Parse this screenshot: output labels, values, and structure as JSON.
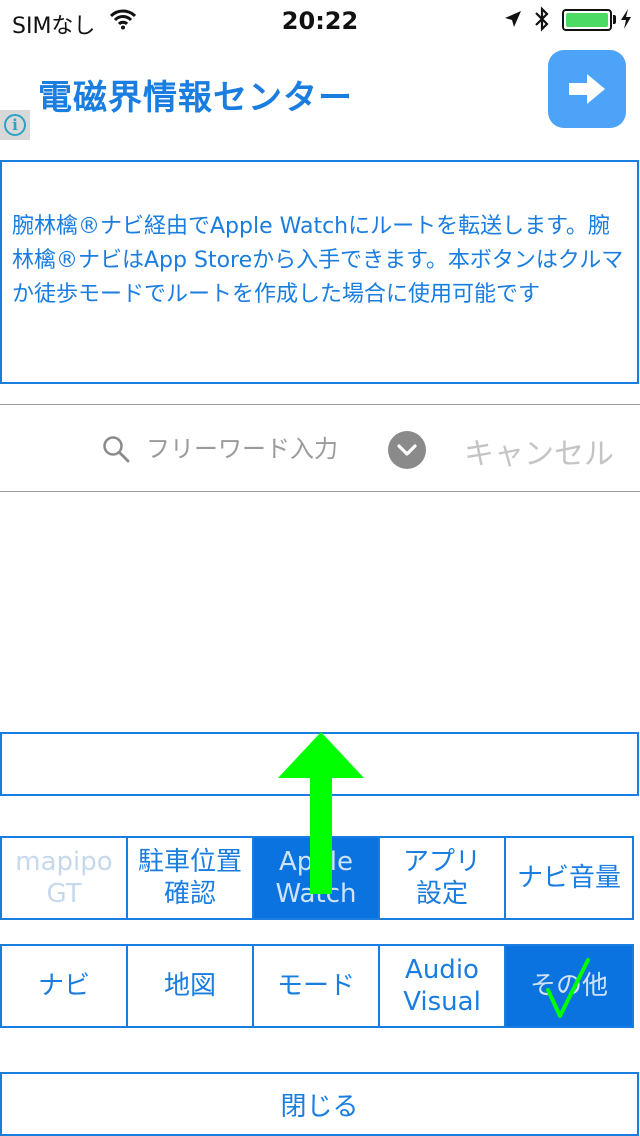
{
  "status_bar": {
    "carrier": "SIMなし",
    "time": "20:22",
    "battery_color": "#4cd964"
  },
  "header": {
    "title": "電磁界情報センター",
    "info_icon": "info-icon",
    "next_icon": "arrow-right-icon",
    "accent_color": "#1a7de0"
  },
  "description": {
    "text": "腕林檎®ナビ経由でApple Watchにルートを転送します。腕林檎®ナビはApp Storeから入手できます。本ボタンはクルマか徒歩モードでルートを作成した場合に使用可能です"
  },
  "search": {
    "placeholder": "フリーワード入力",
    "cancel_label": "キャンセル",
    "search_icon": "search-icon",
    "dropdown_icon": "chevron-down-icon"
  },
  "grid_row1": [
    {
      "label": "mapipo\nGT",
      "state": "disabled"
    },
    {
      "label": "駐車位置\n確認",
      "state": "normal"
    },
    {
      "label": "Apple\nWatch",
      "state": "selected"
    },
    {
      "label": "アプリ\n設定",
      "state": "normal"
    },
    {
      "label": "ナビ音量",
      "state": "normal"
    }
  ],
  "grid_row2": [
    {
      "label": "ナビ",
      "state": "normal"
    },
    {
      "label": "地図",
      "state": "normal"
    },
    {
      "label": "モード",
      "state": "normal"
    },
    {
      "label": "Audio\nVisual",
      "state": "normal"
    },
    {
      "label": "その他",
      "state": "selected"
    }
  ],
  "close_label": "閉じる",
  "annotation": {
    "arrow_color": "#00ff00",
    "check_color": "#00ff00"
  }
}
